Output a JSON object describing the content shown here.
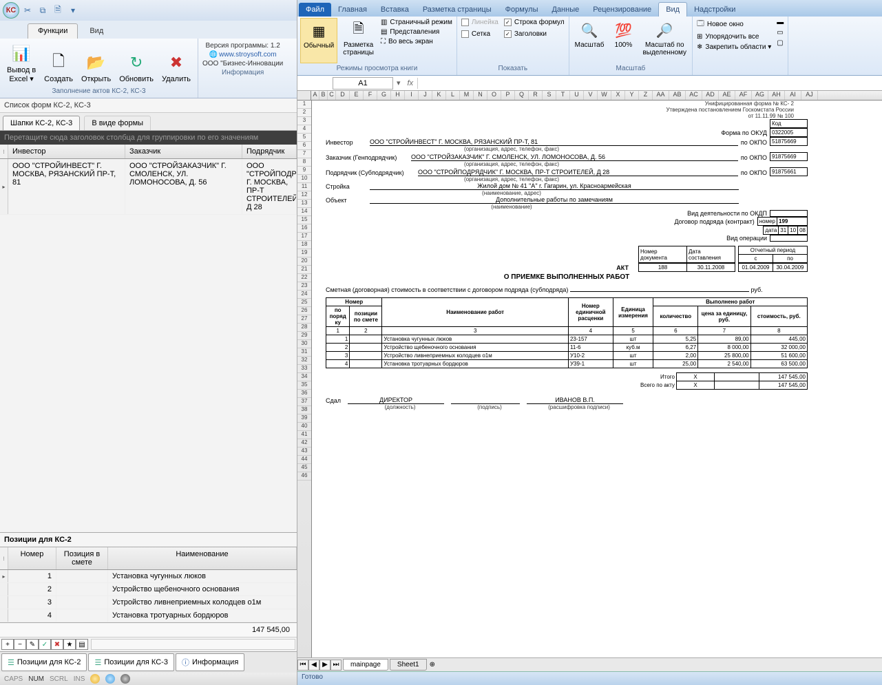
{
  "left": {
    "tabs": {
      "functions": "Функции",
      "view": "Вид"
    },
    "ribbon": {
      "exportExcel": "Вывод в\nExcel ▾",
      "create": "Создать",
      "open": "Открыть",
      "refresh": "Обновить",
      "delete": "Удалить",
      "groupLabel": "Заполнение актов КС-2, КС-3",
      "info": {
        "version": "Версия программы: 1.2",
        "site": "www.stroysoft.com",
        "company": "ООО \"Бизнес-Инновации",
        "label": "Информация"
      }
    },
    "listTitle": "Список форм КС-2, КС-3",
    "listTabs": {
      "hats": "Шапки КС-2, КС-3",
      "formView": "В виде формы"
    },
    "groupHint": "Перетащите сюда заголовок столбца для группировки по его значениям",
    "gridCols": {
      "investor": "Инвестор",
      "customer": "Заказчик",
      "contractor": "Подрядчик"
    },
    "gridRow": {
      "investor": "ООО \"СТРОЙИНВЕСТ\" Г. МОСКВА, РЯЗАНСКИЙ ПР-Т, 81",
      "customer": "ООО \"СТРОЙЗАКАЗЧИК\" Г. СМОЛЕНСК, УЛ. ЛОМОНОСОВА, Д. 56",
      "contractor": "ООО \"СТРОЙПОДРЯДЧИК\" Г. МОСКВА, ПР-Т СТРОИТЕЛЕЙ, Д 28"
    },
    "positionsTitle": "Позиции для КС-2",
    "posCols": {
      "num": "Номер",
      "posInSmeta": "Позиция в смете",
      "name": "Наименование"
    },
    "positions": [
      {
        "n": "1",
        "p": "",
        "name": "Установка чугунных люков"
      },
      {
        "n": "2",
        "p": "",
        "name": "Устройство щебеночного основания"
      },
      {
        "n": "3",
        "p": "",
        "name": "Устройство ливнеприемных колодцев  o1м"
      },
      {
        "n": "4",
        "p": "",
        "name": "Установка тротуарных бордюров"
      }
    ],
    "total": "147 545,00",
    "bottomTabs": {
      "ks2": "Позиции для КС-2",
      "ks3": "Позиции для КС-3",
      "info": "Информация"
    },
    "status": {
      "caps": "CAPS",
      "num": "NUM",
      "scrl": "SCRL",
      "ins": "INS"
    }
  },
  "excel": {
    "tabs": {
      "file": "Файл",
      "home": "Главная",
      "insert": "Вставка",
      "pageLayout": "Разметка страницы",
      "formulas": "Формулы",
      "data": "Данные",
      "review": "Рецензирование",
      "view": "Вид",
      "addins": "Надстройки"
    },
    "ribbon": {
      "normal": "Обычный",
      "pageLayout": "Разметка\nстраницы",
      "pageBreak": "Страничный режим",
      "customViews": "Представления",
      "fullScreen": "Во весь экран",
      "viewsLabel": "Режимы просмотра книги",
      "ruler": "Линейка",
      "formulaBar": "Строка формул",
      "gridlines": "Сетка",
      "headings": "Заголовки",
      "showLabel": "Показать",
      "zoom": "Масштаб",
      "hundred": "100%",
      "zoomSel": "Масштаб по\nвыделенному",
      "zoomLabel": "Масштаб",
      "newWin": "Новое окно",
      "arrange": "Упорядочить все",
      "freeze": "Закрепить области ▾"
    },
    "nameBox": "А1",
    "sheetTabs": {
      "main": "mainpage",
      "s1": "Sheet1"
    },
    "status": "Готово",
    "doc": {
      "formTop1": "Унифицированная форма № КС- 2",
      "formTop2": "Утверждена постановлением Госкомстата России",
      "formTop3": "от 11.11.99 № 100",
      "codeLabel": "Код",
      "okudLabel": "Форма по ОКУД",
      "okud": "0322005",
      "okpo": "по ОКПО",
      "okpo1": "51875669",
      "okpo2": "91875669",
      "okpo3": "91875661",
      "investorLbl": "Инвестор",
      "investorVal": "ООО \"СТРОЙИНВЕСТ\" Г. МОСКВА, РЯЗАНСКИЙ ПР-Т, 81",
      "customerLbl": "Заказчик (Генподрядчик)",
      "customerVal": "ООО \"СТРОЙЗАКАЗЧИК\" Г. СМОЛЕНСК, УЛ. ЛОМОНОСОВА, Д. 56",
      "contractorLbl": "Подрядчик (Субподрядчик)",
      "contractorVal": "ООО \"СТРОЙПОДРЯДЧИК\" Г. МОСКВА, ПР-Т СТРОИТЕЛЕЙ, Д 28",
      "buildLbl": "Стройка",
      "buildVal": "Жилой дом № 41 \"А\" г. Гагарин, ул. Красноармейская",
      "objectLbl": "Объект",
      "objectVal": "Дополнительные работы по замечаниям",
      "orgHint": "(организация, адрес, телефон, факс)",
      "nameAddr": "(наименование, адрес)",
      "nameOnly": "(наименование)",
      "actKind": "Вид деятельности по ОКДП",
      "contractLbl": "Договор подряда (контракт)",
      "numLbl": "номер",
      "contractNum": "199",
      "dateLbl": "дата",
      "d": "31",
      "m": "10",
      "y": "08",
      "opKind": "Вид операции",
      "docNumLbl": "Номер документа",
      "docDateLbl": "Дата составления",
      "periodLbl": "Отчетный период",
      "from": "с",
      "to": "по",
      "act": "АКТ",
      "docNum": "188",
      "docDate": "30.11.2008",
      "pFrom": "01.04.2009",
      "pTo": "30.04.2009",
      "actTitle": "О ПРИЕМКЕ ВЫПОЛНЕННЫХ РАБОТ",
      "contractPrice": "Сметная (договорная) стоимость в соответствии с договором подряда (субподряда)",
      "rub": "руб.",
      "th": {
        "numGroup": "Номер",
        "seq": "по поряд ку",
        "posSmeta": "позиции по смете",
        "workName": "Наименование работ",
        "unitPriceNum": "Номер единичной расценки",
        "unit": "Единица измерения",
        "doneGroup": "Выполнено работ",
        "qty": "количество",
        "price": "цена за единицу, руб.",
        "cost": "стоимость, руб."
      },
      "rows": [
        {
          "n": "1",
          "name": "Установка чугунных люков",
          "code": "23-157",
          "unit": "шт",
          "qty": "5,25",
          "price": "89,00",
          "cost": "445,00"
        },
        {
          "n": "2",
          "name": "Устройство щебеночного основания",
          "code": "11-6",
          "unit": "куб.м",
          "qty": "6,27",
          "price": "8 000,00",
          "cost": "32 000,00"
        },
        {
          "n": "3",
          "name": "Устройство ливнеприемных колодцев  o1м",
          "code": "У10-2",
          "unit": "шт",
          "qty": "2,00",
          "price": "25 800,00",
          "cost": "51 600,00"
        },
        {
          "n": "4",
          "name": "Установка тротуарных бордюров",
          "code": "У39-1",
          "unit": "шт",
          "qty": "25,00",
          "price": "2 540,00",
          "cost": "63 500,00"
        }
      ],
      "itogo": "Итого",
      "itogoX": "X",
      "itogoVal": "147 545,00",
      "vsego": "Всего по акту",
      "vsegoVal": "147 545,00",
      "sdal": "Сдал",
      "director": "ДИРЕКТОР",
      "sign": "(подпись)",
      "pos": "(должность)",
      "ivanov": "ИВАНОВ В.П.",
      "decode": "(расшифровка подписи)"
    }
  }
}
